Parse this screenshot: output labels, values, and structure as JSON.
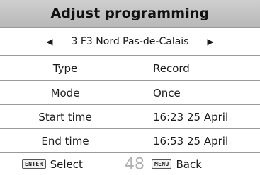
{
  "header": {
    "title": "Adjust programming"
  },
  "channel": {
    "label": "3 F3 Nord Pas-de-Calais",
    "prev_icon": "triangle-left",
    "next_icon": "triangle-right"
  },
  "fields": [
    {
      "label": "Type",
      "value": "Record"
    },
    {
      "label": "Mode",
      "value": "Once"
    },
    {
      "label": "Start time",
      "value": "16:23 25 April"
    },
    {
      "label": "End time",
      "value": "16:53 25 April"
    }
  ],
  "footer": {
    "enter_key": "ENTER",
    "enter_label": "Select",
    "channel_number": "48",
    "menu_key": "MENU",
    "menu_label": "Back"
  }
}
